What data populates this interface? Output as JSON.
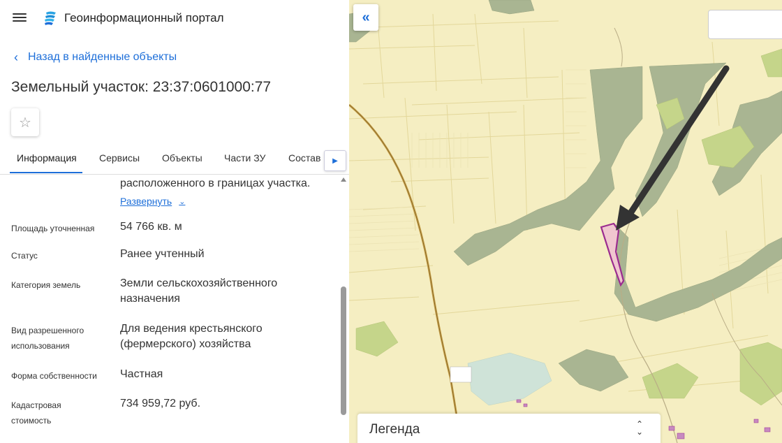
{
  "header": {
    "title": "Геоинформационный портал"
  },
  "nav": {
    "back_label": "Назад в найденные объекты"
  },
  "object": {
    "title": "Земельный участок: 23:37:0601000:77"
  },
  "tabs": [
    "Информация",
    "Сервисы",
    "Объекты",
    "Части ЗУ",
    "Состав"
  ],
  "details": {
    "continuation_text": "расположенного в границах участка.",
    "expand_label": "Развернуть",
    "rows": [
      {
        "label": [
          "Площадь уточненная"
        ],
        "value": [
          "54 766 кв. м"
        ]
      },
      {
        "label": [
          "Статус"
        ],
        "value": [
          "Ранее учтенный"
        ]
      },
      {
        "label": [
          "Категория земель"
        ],
        "value": [
          "Земли сельскохозяйственного",
          "назначения"
        ]
      },
      {
        "label": [
          "Вид разрешенного",
          "использования"
        ],
        "value": [
          "Для ведения крестьянского",
          "(фермерского) хозяйства"
        ]
      },
      {
        "label": [
          "Форма собственности"
        ],
        "value": [
          "Частная"
        ]
      },
      {
        "label": [
          "Кадастровая",
          "стоимость"
        ],
        "value": [
          "734 959,72 руб."
        ]
      }
    ]
  },
  "map": {
    "legend_title": "Легенда",
    "colors": {
      "farmland": "#f5eec2",
      "forest": "#a9b592",
      "grass": "#c5d58a",
      "parcel_fill": "#f0c6cf",
      "parcel_border": "#9b2c8f",
      "road": "#c8a24b",
      "accent": "#1e6fd9"
    }
  }
}
